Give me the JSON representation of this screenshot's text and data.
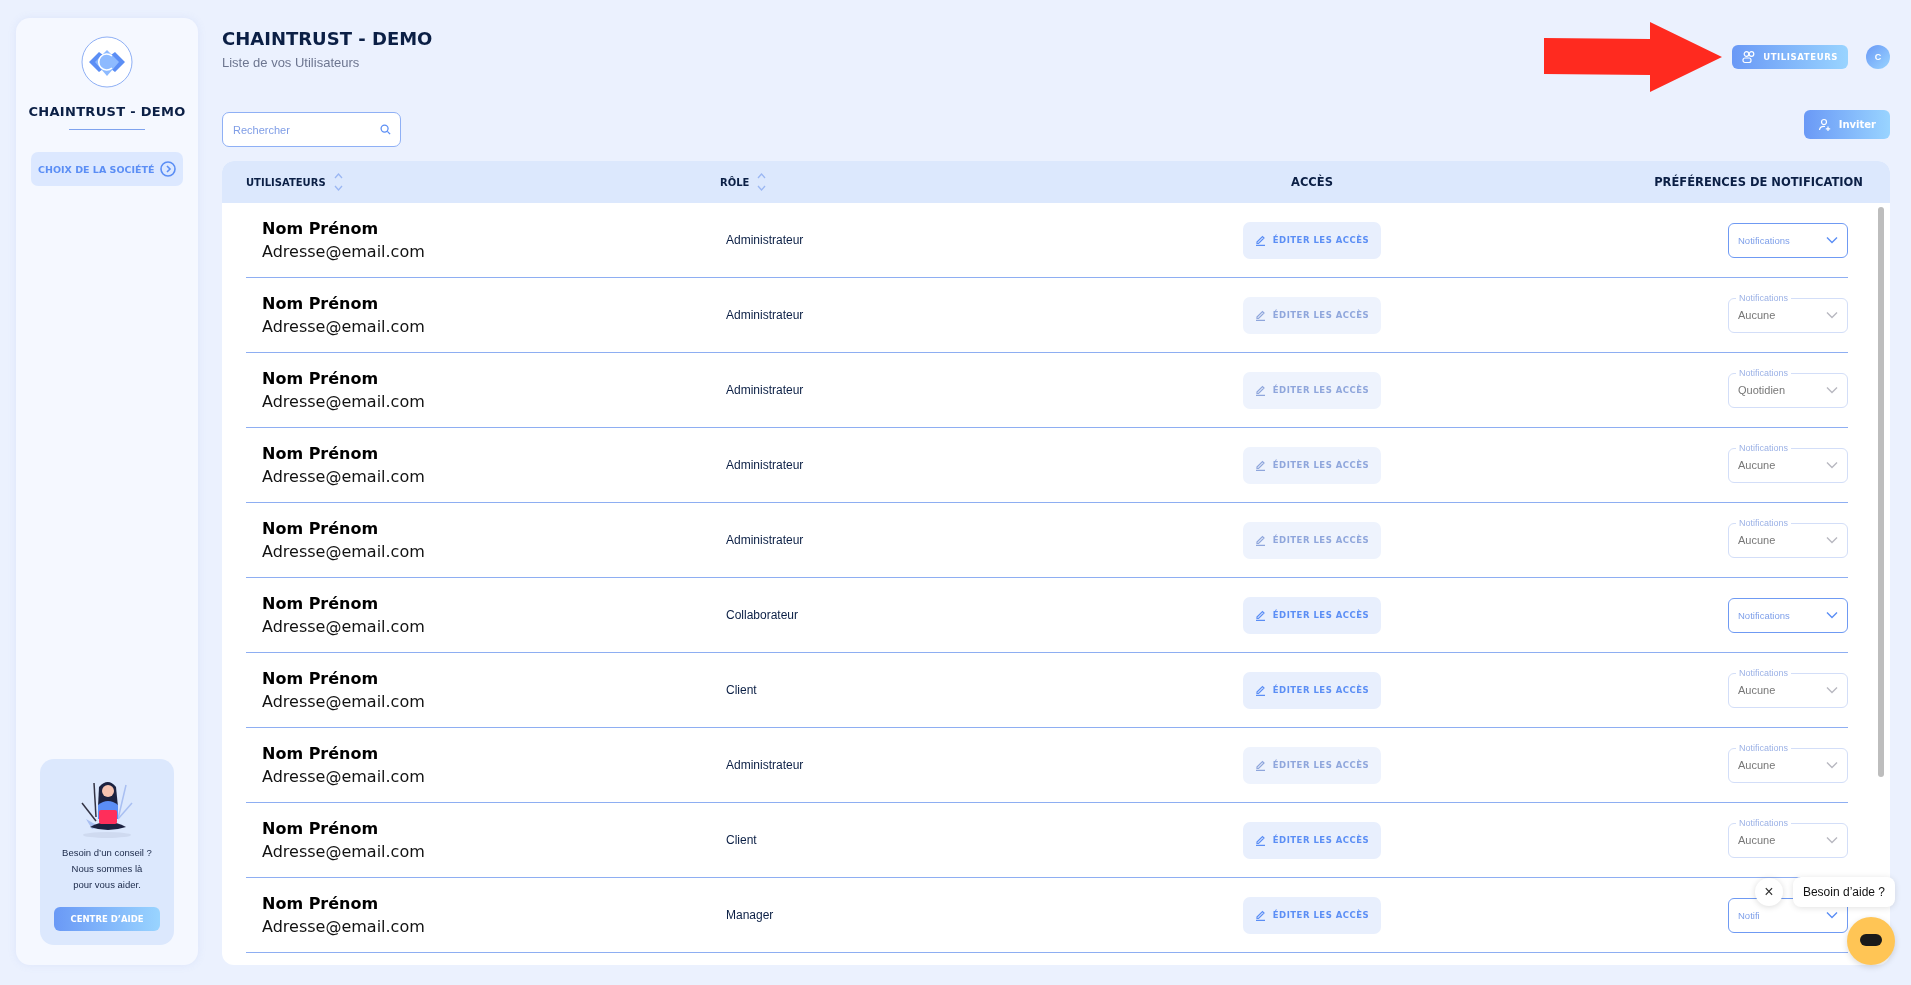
{
  "sidebar": {
    "company": "CHAINTRUST - DEMO",
    "menu": [
      {
        "label": "CHOIX DE LA SOCIÉTÉ",
        "selected": true
      }
    ],
    "help_card": {
      "text": "Besoin d’un conseil ?\nNous sommes là\npour vous aider.",
      "button": "CENTRE D’AIDE"
    }
  },
  "header": {
    "title": "CHAINTRUST - DEMO",
    "subtitle": "Liste de vos Utilisateurs",
    "users_button": "UTILISATEURS",
    "avatar": "C"
  },
  "annotations": [
    {
      "kind": "arrow"
    }
  ],
  "search": {
    "placeholder": "Rechercher"
  },
  "invite_button": "Inviter",
  "table": {
    "columns": [
      {
        "label": "UTILISATEURS",
        "sortable": true
      },
      {
        "label": "RÔLE",
        "sortable": true
      },
      {
        "label": "ACCÈS",
        "sortable": false
      },
      {
        "label": "PRÉFÉRENCES DE NOTIFICATION",
        "sortable": false
      }
    ],
    "rows": [
      {
        "name": "Nom Prénom",
        "email": "Adresse@email.com",
        "role": "Administrateur",
        "access_button": {
          "label": "ÉDITER LES ACCÈS",
          "disabled": false
        },
        "notifications": {
          "label": "Notifications",
          "disabled": false
        }
      },
      {
        "name": "Nom Prénom",
        "email": "Adresse@email.com",
        "role": "Administrateur",
        "access_button": {
          "label": "ÉDITER LES ACCÈS",
          "disabled": true
        },
        "notifications": {
          "label": "Notifications",
          "value": "Aucune",
          "disabled": true
        }
      },
      {
        "name": "Nom Prénom",
        "email": "Adresse@email.com",
        "role": "Administrateur",
        "access_button": {
          "label": "ÉDITER LES ACCÈS",
          "disabled": true
        },
        "notifications": {
          "label": "Notifications",
          "value": "Quotidien",
          "disabled": true
        }
      },
      {
        "name": "Nom Prénom",
        "email": "Adresse@email.com",
        "role": "Administrateur",
        "access_button": {
          "label": "ÉDITER LES ACCÈS",
          "disabled": true
        },
        "notifications": {
          "label": "Notifications",
          "value": "Aucune",
          "disabled": true
        }
      },
      {
        "name": "Nom Prénom",
        "email": "Adresse@email.com",
        "role": "Administrateur",
        "access_button": {
          "label": "ÉDITER LES ACCÈS",
          "disabled": true
        },
        "notifications": {
          "label": "Notifications",
          "value": "Aucune",
          "disabled": true
        }
      },
      {
        "name": "Nom Prénom",
        "email": "Adresse@email.com",
        "role": "Collaborateur",
        "access_button": {
          "label": "ÉDITER LES ACCÈS",
          "disabled": false
        },
        "notifications": {
          "label": "Notifications",
          "disabled": false
        }
      },
      {
        "name": "Nom Prénom",
        "email": "Adresse@email.com",
        "role": "Client",
        "access_button": {
          "label": "ÉDITER LES ACCÈS",
          "disabled": false
        },
        "notifications": {
          "label": "Notifications",
          "value": "Aucune",
          "disabled": true
        }
      },
      {
        "name": "Nom Prénom",
        "email": "Adresse@email.com",
        "role": "Administrateur",
        "access_button": {
          "label": "ÉDITER LES ACCÈS",
          "disabled": true
        },
        "notifications": {
          "label": "Notifications",
          "value": "Aucune",
          "disabled": true
        }
      },
      {
        "name": "Nom Prénom",
        "email": "Adresse@email.com",
        "role": "Client",
        "access_button": {
          "label": "ÉDITER LES ACCÈS",
          "disabled": false
        },
        "notifications": {
          "label": "Notifications",
          "value": "Aucune",
          "disabled": true
        }
      },
      {
        "name": "Nom Prénom",
        "email": "Adresse@email.com",
        "role": "Manager",
        "access_button": {
          "label": "ÉDITER LES ACCÈS",
          "disabled": false
        },
        "notifications": {
          "label": "Notifi",
          "disabled": false
        }
      }
    ]
  },
  "chat": {
    "bubble": "Besoin d’aide ?",
    "close": "×"
  }
}
